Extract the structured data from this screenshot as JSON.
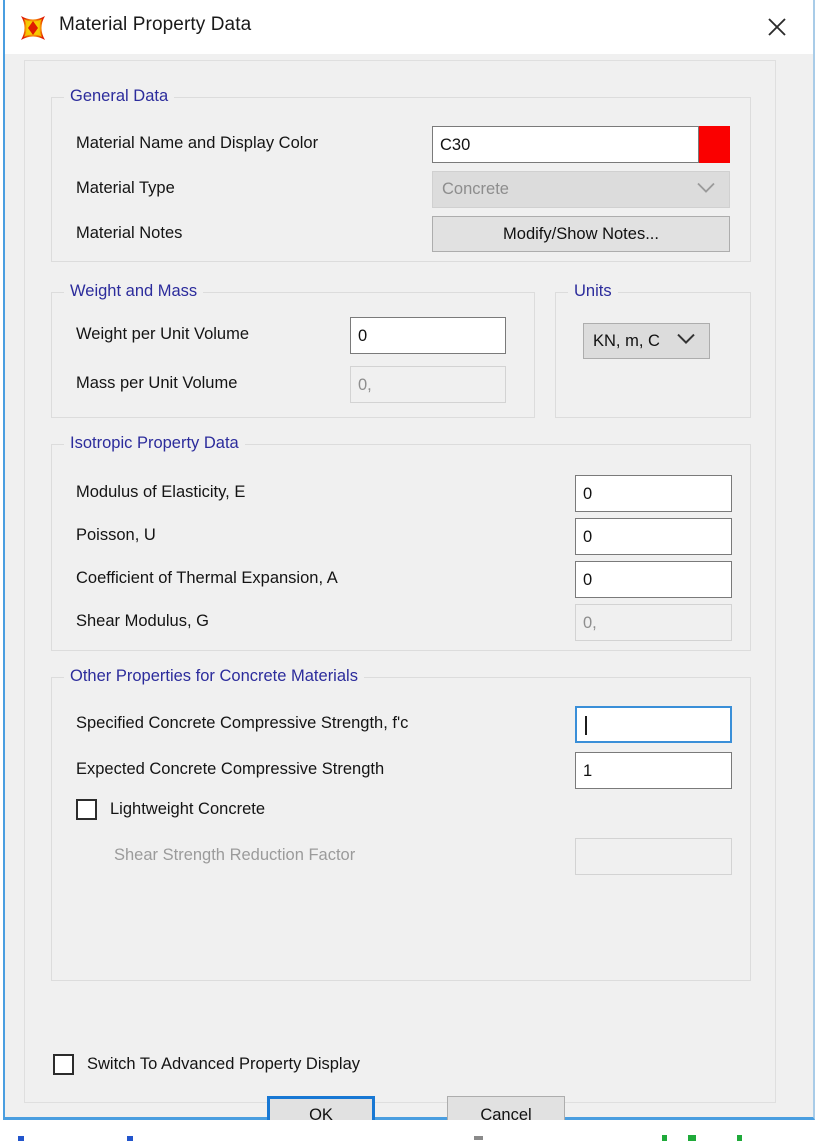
{
  "window": {
    "title": "Material Property Data",
    "icon": "app-star-icon",
    "close_label": "×",
    "accent_color": "#4a9ee0"
  },
  "general_data": {
    "legend": "General Data",
    "name_label": "Material Name and Display Color",
    "name_value": "C30",
    "display_color": "#fa0000",
    "type_label": "Material Type",
    "type_value": "Concrete",
    "notes_label": "Material Notes",
    "notes_button": "Modify/Show Notes..."
  },
  "weight_and_mass": {
    "legend": "Weight and Mass",
    "weight_label": "Weight per Unit Volume",
    "weight_value": "0",
    "mass_label": "Mass per Unit Volume",
    "mass_value": "0,"
  },
  "units": {
    "legend": "Units",
    "value": "KN, m, C"
  },
  "isotropic": {
    "legend": "Isotropic Property Data",
    "rows": [
      {
        "label": "Modulus of Elasticity,  E",
        "value": "0"
      },
      {
        "label": "Poisson, U",
        "value": "0"
      },
      {
        "label": "Coefficient of Thermal Expansion,  A",
        "value": "0"
      },
      {
        "label": "Shear Modulus,  G",
        "value": "0,"
      }
    ]
  },
  "concrete": {
    "legend": "Other Properties for Concrete Materials",
    "fc_label": "Specified Concrete Compressive Strength, f'c",
    "fc_value": "",
    "expected_label": "Expected Concrete Compressive Strength",
    "expected_value": "1",
    "lightweight_label": "Lightweight Concrete",
    "shear_reduction_label": "Shear Strength Reduction Factor",
    "shear_reduction_value": ""
  },
  "footer": {
    "advanced_label": "Switch To Advanced Property Display",
    "ok_label": "OK",
    "cancel_label": "Cancel"
  }
}
